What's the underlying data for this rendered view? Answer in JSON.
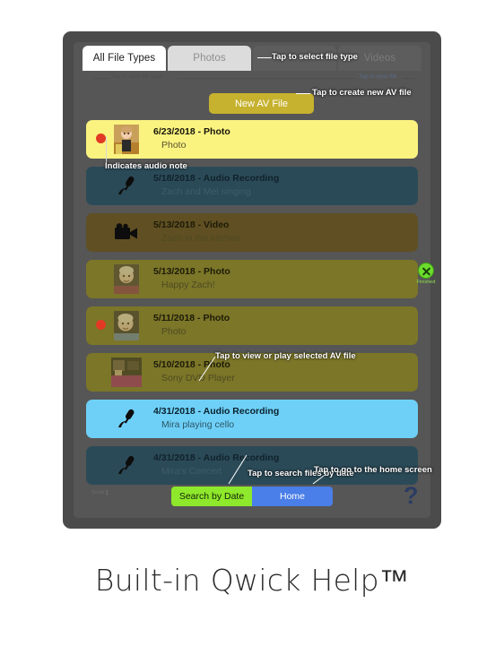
{
  "caption": "Built-in Qwick Help™",
  "tabs": [
    {
      "label": "All File Types",
      "state": "active"
    },
    {
      "label": "Photos",
      "state": "semi"
    },
    {
      "label": "Videos",
      "state": "dim"
    }
  ],
  "buttons": {
    "new_av_file": "New AV File",
    "search_by_date": "Search by Date",
    "home": "Home",
    "help_icon": "question-mark-icon"
  },
  "scroll_label": "Scroll",
  "status_badge": {
    "label": "Finished",
    "icon": "green-x-circle-icon",
    "color": "#6ddd2c"
  },
  "annotations": {
    "select_file_type": "Tap to select file type",
    "create_new_av": "Tap to create new AV file",
    "view_file_type": "Tap to view file type",
    "view_file": "Tap to view file",
    "audio_note": "Indicates audio note",
    "view_or_play": "Tap to view or play selected AV file",
    "search_by_date": "Tap to search files by date",
    "home_screen": "Tap to go to the home screen"
  },
  "list": [
    {
      "date": "6/23/2018 - Photo",
      "description": "Photo",
      "type": "photo",
      "selected": true,
      "audio_note": true,
      "thumbnail": "photo-child-thumbnail"
    },
    {
      "date": "5/18/2018 - Audio Recording",
      "description": "Zach and Mel singing",
      "type": "audio",
      "selected": false,
      "audio_note": false,
      "thumbnail": "microphone-icon"
    },
    {
      "date": "5/13/2018 - Video",
      "description": "Zach in the kitchen",
      "type": "video",
      "selected": false,
      "audio_note": false,
      "thumbnail": "video-camera-icon"
    },
    {
      "date": "5/13/2018 - Photo",
      "description": "Happy Zach!",
      "type": "photo",
      "selected": false,
      "audio_note": false,
      "thumbnail": "photo-baby-thumbnail"
    },
    {
      "date": "5/11/2018 - Photo",
      "description": "Photo",
      "type": "photo",
      "selected": false,
      "audio_note": true,
      "thumbnail": "photo-baby-thumbnail"
    },
    {
      "date": "5/10/2018 - Photo",
      "description": "Sony DVD Player",
      "type": "photo",
      "selected": false,
      "audio_note": false,
      "thumbnail": "photo-room-thumbnail"
    },
    {
      "date": "4/31/2018 - Audio Recording",
      "description": "Mira playing cello",
      "type": "audio",
      "selected": true,
      "audio_note": false,
      "thumbnail": "microphone-icon"
    },
    {
      "date": "4/31/2018 - Audio Recording",
      "description": "Mira's Concert",
      "type": "audio",
      "selected": false,
      "audio_note": false,
      "thumbnail": "microphone-icon"
    }
  ],
  "colors": {
    "frame": "#4b4b4b",
    "screen": "#565656",
    "photo_row": "#7b7628",
    "audio_row": "#2b4a58",
    "video_row": "#5f4f22",
    "photo_selected": "#fbf380",
    "audio_selected": "#6fd0f7",
    "new_av": "#c6b22e",
    "search_green": "#8ee82b",
    "home_blue": "#4a7ee8",
    "red_dot": "#e23a24"
  }
}
